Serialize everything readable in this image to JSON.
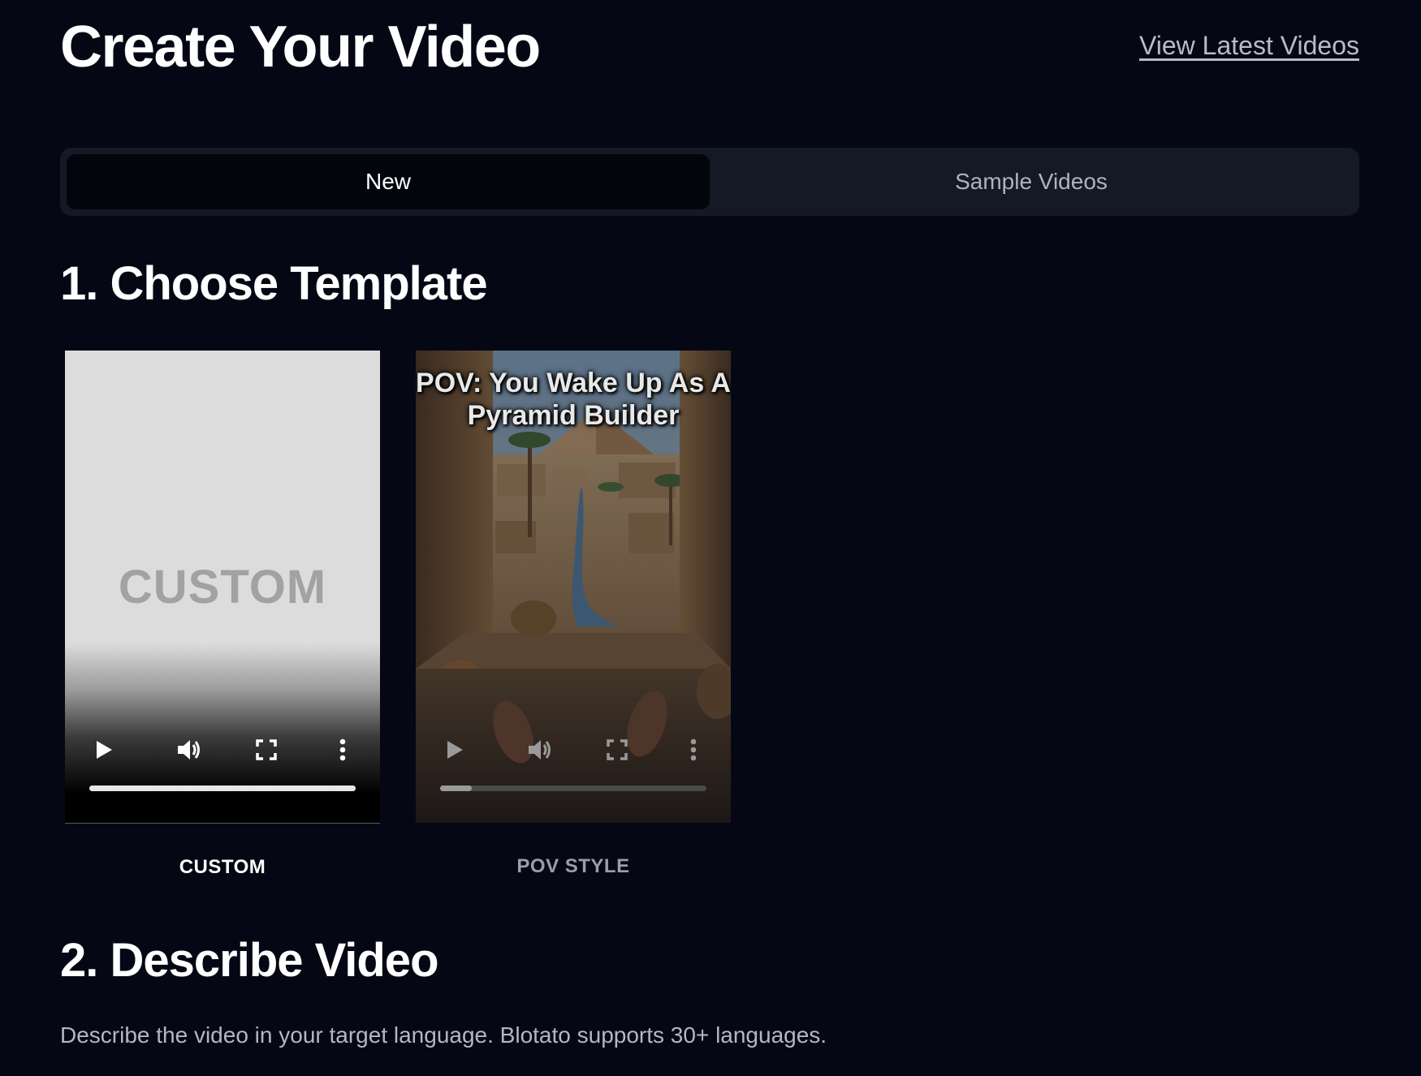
{
  "header": {
    "title": "Create Your Video",
    "latest_link": "View Latest Videos"
  },
  "tabs": [
    {
      "label": "New",
      "active": true
    },
    {
      "label": "Sample Videos",
      "active": false
    }
  ],
  "section1": {
    "title": "1. Choose Template",
    "templates": [
      {
        "thumbnail_text": "CUSTOM",
        "label": "CUSTOM",
        "selected": true,
        "progress": 1.0
      },
      {
        "caption": "POV: You Wake Up As A Pyramid Builder",
        "label": "POV STYLE",
        "selected": false,
        "progress": 0.12
      }
    ]
  },
  "section2": {
    "title": "2. Describe Video",
    "description": "Describe the video in your target language. Blotato supports 30+ languages."
  },
  "icons": {
    "play": "play-icon",
    "volume": "volume-icon",
    "fullscreen": "fullscreen-icon",
    "more": "more-vertical-icon"
  }
}
